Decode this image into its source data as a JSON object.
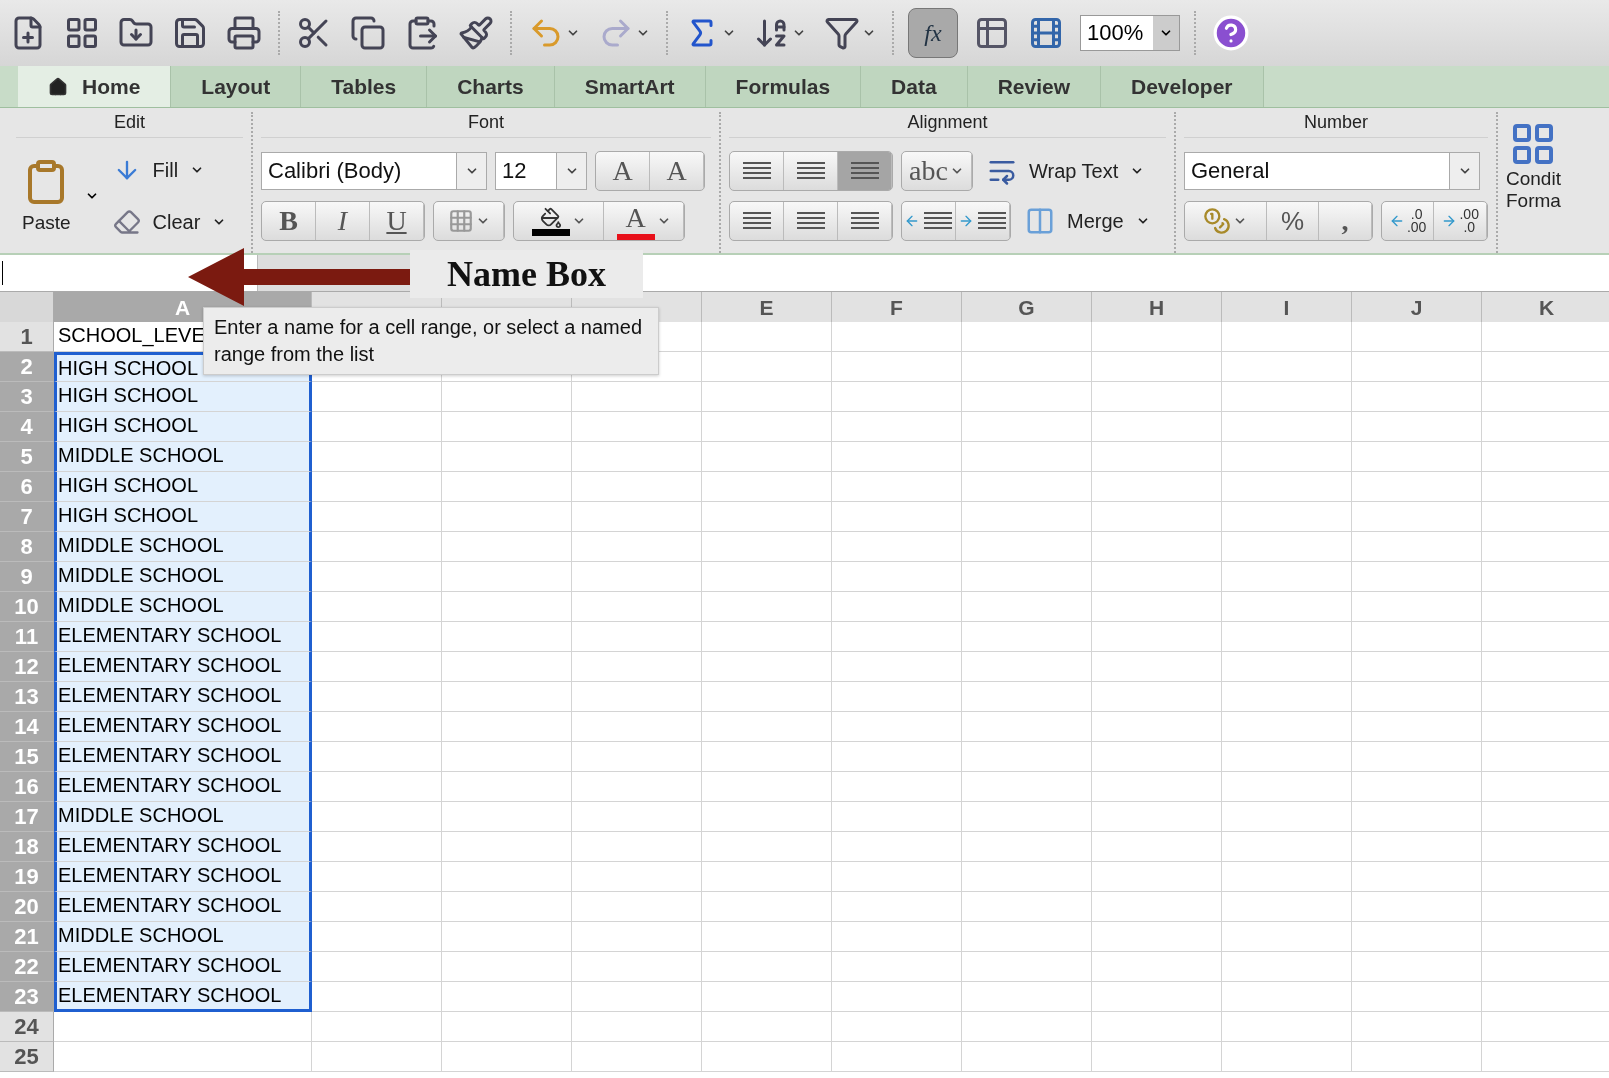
{
  "toolbar": {
    "function_button": {
      "label": "fx",
      "selected": true
    },
    "zoom": "100%"
  },
  "tabs": [
    {
      "label": "Home",
      "selected": true
    },
    {
      "label": "Layout",
      "selected": false
    },
    {
      "label": "Tables",
      "selected": false
    },
    {
      "label": "Charts",
      "selected": false
    },
    {
      "label": "SmartArt",
      "selected": false
    },
    {
      "label": "Formulas",
      "selected": false
    },
    {
      "label": "Data",
      "selected": false
    },
    {
      "label": "Review",
      "selected": false
    },
    {
      "label": "Developer",
      "selected": false
    }
  ],
  "ribbon": {
    "edit": {
      "title": "Edit",
      "paste": "Paste",
      "fill": "Fill",
      "clear": "Clear"
    },
    "font": {
      "title": "Font",
      "name": "Calibri (Body)",
      "size": "12",
      "grow": "A",
      "shrink": "A",
      "bold": "B",
      "italic": "I",
      "underline": "U",
      "font_color": "A"
    },
    "alignment": {
      "title": "Alignment",
      "vertical": [
        {
          "selected": false
        },
        {
          "selected": false
        },
        {
          "selected": true
        }
      ],
      "orientation": "abc",
      "wrap": "Wrap Text",
      "merge": "Merge"
    },
    "number": {
      "title": "Number",
      "format": "General",
      "percent": "%",
      "comma": ",",
      "decrease_decimal": [
        ".0",
        ".00"
      ],
      "increase_decimal": [
        ".00",
        ".0"
      ]
    },
    "conditional": [
      "Condit",
      "Forma"
    ]
  },
  "annotation": {
    "label": "Name Box"
  },
  "tooltip": {
    "text": "Enter a name for a cell range, or select a named range from the list"
  },
  "sheet": {
    "columns": [
      {
        "label": "A",
        "selected": true
      },
      {
        "selected": false
      },
      {
        "selected": false
      },
      {
        "selected": false
      },
      {
        "label": "E",
        "selected": false
      },
      {
        "label": "F",
        "selected": false
      },
      {
        "label": "G",
        "selected": false
      },
      {
        "label": "H",
        "selected": false
      },
      {
        "label": "I",
        "selected": false
      },
      {
        "label": "J",
        "selected": false
      },
      {
        "label": "K",
        "selected": false
      }
    ],
    "rows": [
      {
        "number": "1",
        "cell": "SCHOOL_LEVE",
        "selected": false
      },
      {
        "number": "2",
        "cell": "HIGH SCHOOL",
        "selected": true
      },
      {
        "number": "3",
        "cell": "HIGH SCHOOL",
        "selected": true
      },
      {
        "number": "4",
        "cell": "HIGH SCHOOL",
        "selected": true
      },
      {
        "number": "5",
        "cell": "MIDDLE SCHOOL",
        "selected": true
      },
      {
        "number": "6",
        "cell": "HIGH SCHOOL",
        "selected": true
      },
      {
        "number": "7",
        "cell": "HIGH SCHOOL",
        "selected": true
      },
      {
        "number": "8",
        "cell": "MIDDLE SCHOOL",
        "selected": true
      },
      {
        "number": "9",
        "cell": "MIDDLE SCHOOL",
        "selected": true
      },
      {
        "number": "10",
        "cell": "MIDDLE SCHOOL",
        "selected": true
      },
      {
        "number": "11",
        "cell": "ELEMENTARY SCHOOL",
        "selected": true
      },
      {
        "number": "12",
        "cell": "ELEMENTARY SCHOOL",
        "selected": true
      },
      {
        "number": "13",
        "cell": "ELEMENTARY SCHOOL",
        "selected": true
      },
      {
        "number": "14",
        "cell": "ELEMENTARY SCHOOL",
        "selected": true
      },
      {
        "number": "15",
        "cell": "ELEMENTARY SCHOOL",
        "selected": true
      },
      {
        "number": "16",
        "cell": "ELEMENTARY SCHOOL",
        "selected": true
      },
      {
        "number": "17",
        "cell": "MIDDLE SCHOOL",
        "selected": true
      },
      {
        "number": "18",
        "cell": "ELEMENTARY SCHOOL",
        "selected": true
      },
      {
        "number": "19",
        "cell": "ELEMENTARY SCHOOL",
        "selected": true
      },
      {
        "number": "20",
        "cell": "ELEMENTARY SCHOOL",
        "selected": true
      },
      {
        "number": "21",
        "cell": "MIDDLE SCHOOL",
        "selected": true
      },
      {
        "number": "22",
        "cell": "ELEMENTARY SCHOOL",
        "selected": true
      },
      {
        "number": "23",
        "cell": "ELEMENTARY SCHOOL",
        "selected": true
      },
      {
        "number": "24",
        "selected": false
      },
      {
        "number": "25",
        "selected": false
      }
    ]
  }
}
